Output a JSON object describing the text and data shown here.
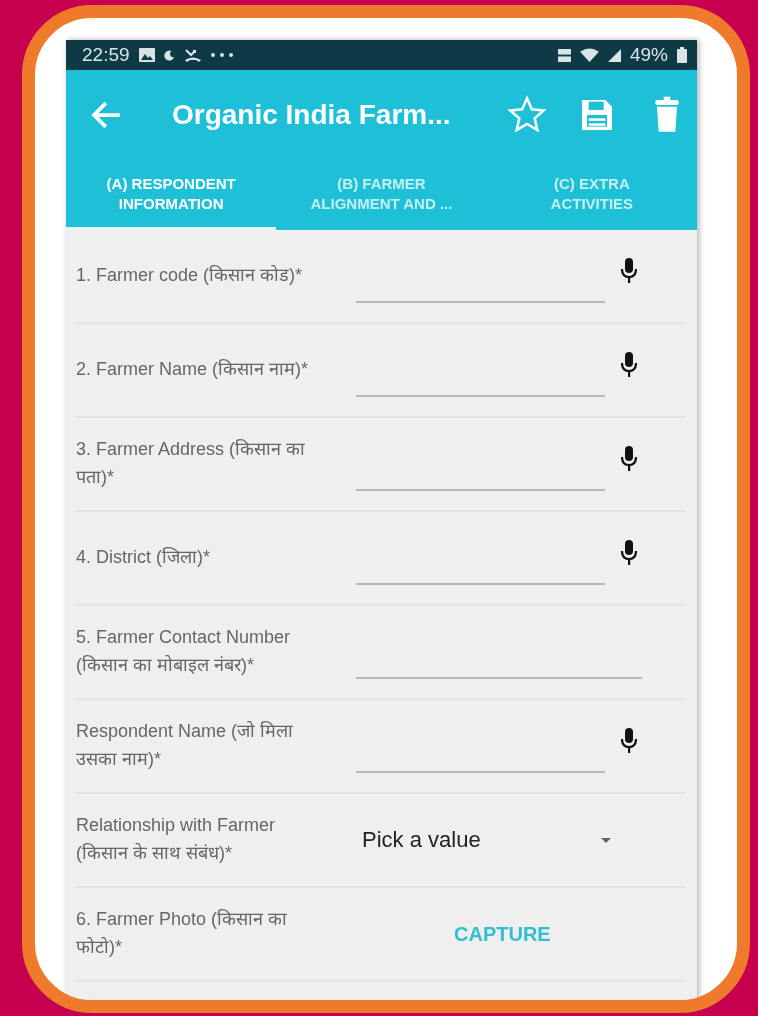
{
  "status_bar": {
    "time": "22:59",
    "battery": "49%"
  },
  "app_bar": {
    "title": "Organic India Farm..."
  },
  "tabs": [
    {
      "label": "(A) RESPONDENT INFORMATION",
      "selected": true
    },
    {
      "label": "(B) FARMER ALIGNMENT AND ...",
      "selected": false
    },
    {
      "label": "(C) EXTRA ACTIVITIES",
      "selected": false
    }
  ],
  "fields": [
    {
      "kind": "text",
      "label": "1. Farmer code (किसान कोड)*",
      "mic": true
    },
    {
      "kind": "text",
      "label": "2. Farmer Name (किसान नाम)*",
      "mic": true
    },
    {
      "kind": "text",
      "label": "3. Farmer Address (किसान का पता)*",
      "mic": true
    },
    {
      "kind": "text",
      "label": "4. District (जिला)*",
      "mic": true
    },
    {
      "kind": "text",
      "label": "5. Farmer Contact Number (किसान का मोबाइल नंबर)*",
      "mic": false
    },
    {
      "kind": "text",
      "label": "Respondent Name (जो मिला उसका नाम)*",
      "mic": true
    },
    {
      "kind": "dropdown",
      "label": "Relationship with Farmer (किसान के साथ संबंध)*",
      "value": "Pick a value"
    },
    {
      "kind": "capture",
      "label": "6. Farmer Photo (किसान का फोटो)*",
      "button": "CAPTURE"
    }
  ]
}
